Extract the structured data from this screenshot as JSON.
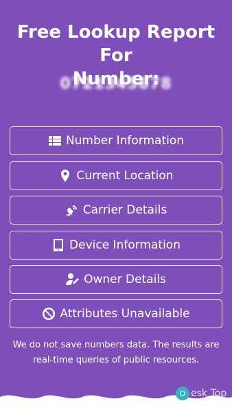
{
  "header": {
    "title_line1": "Free Lookup Report For",
    "title_line2": "Number:",
    "phone_number": "0721345678"
  },
  "buttons": [
    {
      "label": "Number Information",
      "icon": "list-icon"
    },
    {
      "label": "Current Location",
      "icon": "location-pin-icon"
    },
    {
      "label": "Carrier Details",
      "icon": "satellite-dish-icon"
    },
    {
      "label": "Device Information",
      "icon": "tablet-icon"
    },
    {
      "label": "Owner Details",
      "icon": "user-edit-icon"
    },
    {
      "label": "Attributes Unavailable",
      "icon": "ban-icon"
    }
  ],
  "footer": {
    "note": "We do not save numbers data. The results are real-time queries of public resources."
  },
  "watermark": {
    "text": "esk Top",
    "logo_letter": "D"
  },
  "colors": {
    "background": "#7e4fb8",
    "text": "#ffffff"
  }
}
